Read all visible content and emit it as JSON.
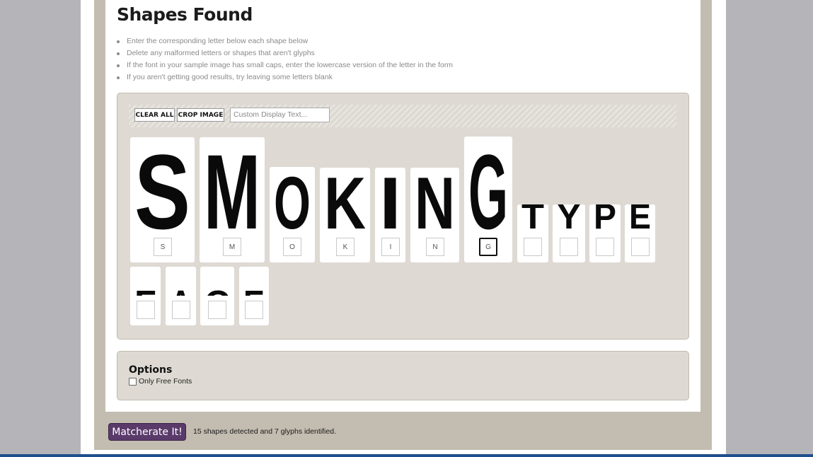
{
  "page": {
    "title": "Shapes Found"
  },
  "instructions": [
    "Enter the corresponding letter below each shape below",
    "Delete any malformed letters or shapes that aren't glyphs",
    "If the font in your sample image has small caps, enter the lowercase version of the letter in the form",
    "If you aren't getting good results, try leaving some letters blank"
  ],
  "toolbar": {
    "clear_all_label": "CLEAR ALL",
    "crop_image_label": "CROP IMAGE",
    "display_text_placeholder": "Custom Display Text..."
  },
  "glyphs": [
    {
      "shape": "S",
      "value": "S"
    },
    {
      "shape": "M",
      "value": "M"
    },
    {
      "shape": "O",
      "value": "O"
    },
    {
      "shape": "K",
      "value": "K"
    },
    {
      "shape": "I",
      "value": "I"
    },
    {
      "shape": "N",
      "value": "N"
    },
    {
      "shape": "G",
      "value": "G"
    },
    {
      "shape": "T",
      "value": ""
    },
    {
      "shape": "Y",
      "value": ""
    },
    {
      "shape": "P",
      "value": ""
    },
    {
      "shape": "E",
      "value": ""
    },
    {
      "shape": "F",
      "value": ""
    },
    {
      "shape": "A",
      "value": ""
    },
    {
      "shape": "C",
      "value": ""
    },
    {
      "shape": "E",
      "value": ""
    }
  ],
  "options": {
    "title": "Options",
    "only_free_fonts_label": "Only Free Fonts"
  },
  "submit": {
    "label": "Matcherate It!"
  },
  "status": {
    "text": "15 shapes detected and 7 glyphs identified."
  }
}
